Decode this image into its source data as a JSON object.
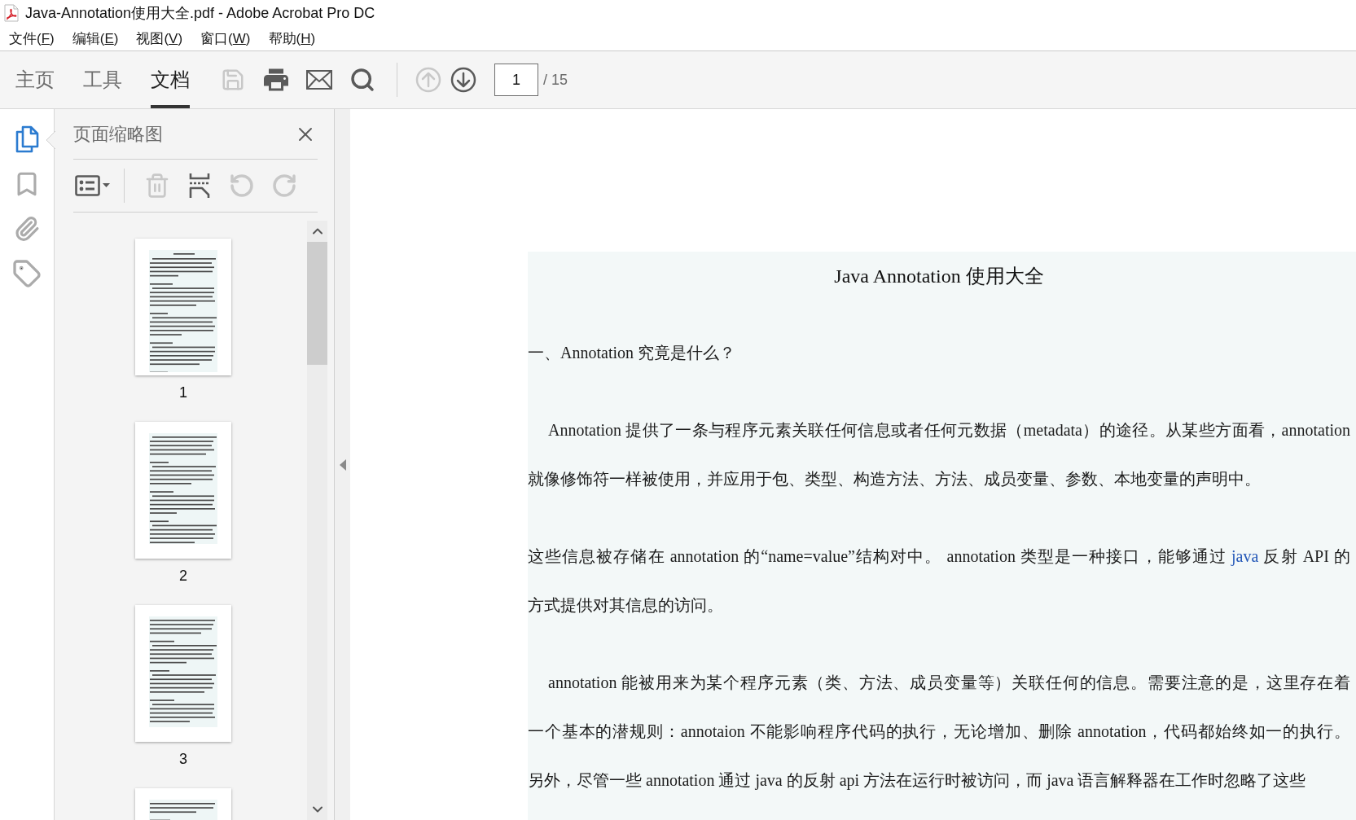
{
  "window": {
    "title": "Java-Annotation使用大全.pdf - Adobe Acrobat Pro DC"
  },
  "menu": [
    {
      "before": "文件(",
      "access_key": "F",
      "after": ")"
    },
    {
      "before": "编辑(",
      "access_key": "E",
      "after": ")"
    },
    {
      "before": "视图(",
      "access_key": "V",
      "after": ")"
    },
    {
      "before": "窗口(",
      "access_key": "W",
      "after": ")"
    },
    {
      "before": "帮助(",
      "access_key": "H",
      "after": ")"
    }
  ],
  "tabs": [
    {
      "label": "主页",
      "selected": false
    },
    {
      "label": "工具",
      "selected": false
    },
    {
      "label": "文档",
      "selected": true
    }
  ],
  "toolbar_buttons": [
    {
      "disabled": true
    },
    {
      "disabled": false
    },
    {
      "disabled": false
    },
    {
      "disabled": false
    }
  ],
  "page_nav": {
    "previous": {
      "disabled": true
    },
    "next": {
      "disabled": false
    },
    "page_field": {
      "value": "1"
    },
    "page_count": "/ 15"
  },
  "side_nav": [
    {
      "selected": true
    },
    {
      "selected": false
    },
    {
      "selected": false
    },
    {
      "selected": false
    }
  ],
  "thumbnails_panel": {
    "title": "页面缩略图",
    "tools": [
      {
        "disabled": false
      },
      {
        "disabled": true
      },
      {
        "disabled": false
      },
      {
        "disabled": true
      },
      {
        "disabled": true
      }
    ],
    "thumbnails": [
      {
        "label": "1"
      },
      {
        "label": "2"
      },
      {
        "label": "3"
      }
    ],
    "more_below": true
  },
  "document": {
    "title": "Java Annotation 使用大全",
    "section_heading": "一、Annotation 究竟是什么？",
    "paragraphs": [
      {
        "indented": true,
        "lines": [
          [
            {
              "kind": "text",
              "text": "Annotation 提供了一条与程序元素关联任何信息或者任何元数据（metadata）的途径。从某些方面看，annotation"
            }
          ],
          [
            {
              "kind": "text",
              "text": "就像修饰符一样被使用，并应用于包、类型、构造方法、方法、成员变量、参数、本地变量的声明中。"
            }
          ]
        ]
      },
      {
        "indented": false,
        "lines": [
          [
            {
              "kind": "text",
              "text": "这些信息被存储在 annotation 的“name=value”结构对中。 annotation 类型是一种接口，能够通过 "
            },
            {
              "kind": "link",
              "text": "java"
            },
            {
              "kind": "text",
              "text": " 反射 API 的"
            }
          ],
          [
            {
              "kind": "text",
              "text": "方式提供对其信息的访问。"
            }
          ]
        ]
      },
      {
        "indented": true,
        "lines": [
          [
            {
              "kind": "text",
              "text": "annotation 能被用来为某个程序元素（类、方法、成员变量等）关联任何的信息。需要注意的是，这里存在着"
            }
          ],
          [
            {
              "kind": "text",
              "text": "一个基本的潜规则：annotaion 不能影响程序代码的执行，无论增加、删除 annotation，代码都始终如一的执行。"
            }
          ],
          [
            {
              "kind": "text",
              "text": "另外，尽管一些 annotation 通过 java 的反射 api 方法在运行时被访问，而 java 语言解释器在工作时忽略了这些"
            }
          ]
        ]
      }
    ]
  }
}
